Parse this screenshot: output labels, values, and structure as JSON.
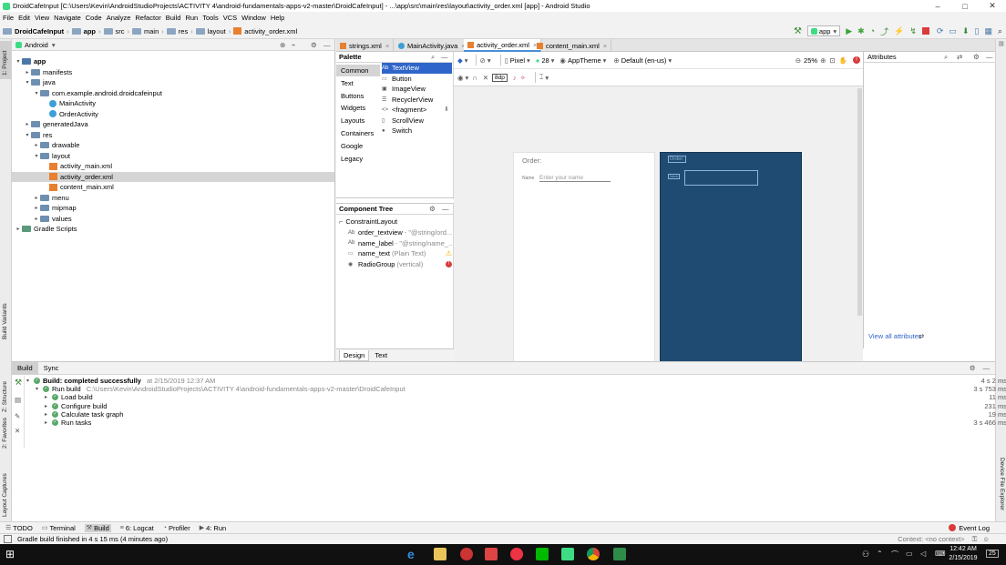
{
  "window": {
    "title": "DroidCafeInput [C:\\Users\\Kevin\\AndroidStudioProjects\\ACTIVITY 4\\android-fundamentals-apps-v2-master\\DroidCafeInput] - ...\\app\\src\\main\\res\\layout\\activity_order.xml [app] - Android Studio"
  },
  "menu": [
    "File",
    "Edit",
    "View",
    "Navigate",
    "Code",
    "Analyze",
    "Refactor",
    "Build",
    "Run",
    "Tools",
    "VCS",
    "Window",
    "Help"
  ],
  "breadcrumb": [
    "DroidCafeInput",
    "app",
    "src",
    "main",
    "res",
    "layout",
    "activity_order.xml"
  ],
  "run_config": "app",
  "left_strip": {
    "project": "1: Project",
    "build_variants": "Build Variants",
    "structure": "Z: Structure",
    "favorites": "2: Favorites",
    "layout_captures": "Layout Captures"
  },
  "right_strip": {
    "device_explorer": "Device File Explorer"
  },
  "project_panel": {
    "view": "Android"
  },
  "tree": [
    {
      "label": "app",
      "level": 0,
      "kind": "module",
      "arrow": "▾",
      "bold": true
    },
    {
      "label": "manifests",
      "level": 1,
      "kind": "folder",
      "arrow": "▸"
    },
    {
      "label": "java",
      "level": 1,
      "kind": "folder",
      "arrow": "▾"
    },
    {
      "label": "com.example.android.droidcafeinput",
      "level": 2,
      "kind": "folder",
      "arrow": "▾"
    },
    {
      "label": "MainActivity",
      "level": 3,
      "kind": "class",
      "arrow": ""
    },
    {
      "label": "OrderActivity",
      "level": 3,
      "kind": "class",
      "arrow": ""
    },
    {
      "label": "generatedJava",
      "level": 1,
      "kind": "folder",
      "arrow": "▸"
    },
    {
      "label": "res",
      "level": 1,
      "kind": "folder",
      "arrow": "▾"
    },
    {
      "label": "drawable",
      "level": 2,
      "kind": "folder",
      "arrow": "▸"
    },
    {
      "label": "layout",
      "level": 2,
      "kind": "folder",
      "arrow": "▾"
    },
    {
      "label": "activity_main.xml",
      "level": 3,
      "kind": "xml",
      "arrow": ""
    },
    {
      "label": "activity_order.xml",
      "level": 3,
      "kind": "xml",
      "arrow": "",
      "selected": true
    },
    {
      "label": "content_main.xml",
      "level": 3,
      "kind": "xml",
      "arrow": ""
    },
    {
      "label": "menu",
      "level": 2,
      "kind": "folder",
      "arrow": "▸"
    },
    {
      "label": "mipmap",
      "level": 2,
      "kind": "folder",
      "arrow": "▸"
    },
    {
      "label": "values",
      "level": 2,
      "kind": "folder",
      "arrow": "▸"
    },
    {
      "label": "Gradle Scripts",
      "level": 0,
      "kind": "gradle",
      "arrow": "▸"
    }
  ],
  "editor_tabs": [
    {
      "label": "strings.xml",
      "active": false
    },
    {
      "label": "MainActivity.java",
      "active": false
    },
    {
      "label": "activity_order.xml",
      "active": true
    },
    {
      "label": "content_main.xml",
      "active": false
    }
  ],
  "palette": {
    "title": "Palette",
    "categories": [
      "Common",
      "Text",
      "Buttons",
      "Widgets",
      "Layouts",
      "Containers",
      "Google",
      "Legacy"
    ],
    "widgets": [
      {
        "prefix": "Ab",
        "label": "TextView",
        "selected": true
      },
      {
        "prefix": "",
        "label": "Button"
      },
      {
        "prefix": "",
        "label": "ImageView"
      },
      {
        "prefix": "",
        "label": "RecyclerView"
      },
      {
        "prefix": "<>",
        "label": "<fragment>"
      },
      {
        "prefix": "",
        "label": "ScrollView"
      },
      {
        "prefix": "",
        "label": "Switch"
      }
    ]
  },
  "component_tree": {
    "title": "Component Tree",
    "root": "ConstraintLayout",
    "items": [
      {
        "prefix": "Ab",
        "name": "order_textview",
        "hint": "- \"@string/ord...",
        "status": ""
      },
      {
        "prefix": "Ab",
        "name": "name_label",
        "hint": "- \"@string/name_...",
        "status": ""
      },
      {
        "prefix": "",
        "name": "name_text",
        "hint": "(Plain Text)",
        "status": "warning"
      },
      {
        "prefix": "◉",
        "name": "RadioGroup",
        "hint": "(vertical)",
        "status": "error"
      }
    ]
  },
  "design_tabs": [
    "Design",
    "Text"
  ],
  "toolbar": {
    "device": "Pixel",
    "api": "28",
    "theme": "AppTheme",
    "locale": "Default (en-us)",
    "zoom": "25%",
    "margin": "8dp"
  },
  "canvas": {
    "order_label": "Order:",
    "name_label": "Name",
    "name_hint": "Enter your name",
    "blue_order": "Order:",
    "blue_name": "Name"
  },
  "attributes": {
    "title": "Attributes",
    "view_all": "View all attributes"
  },
  "build_panel": {
    "tabs": [
      "Build",
      "Sync"
    ],
    "rows": [
      {
        "text": "Build: completed successfully",
        "extra": "at 2/15/2019 12:37 AM",
        "duration": "4 s 2 ms",
        "level": 0,
        "bold": true
      },
      {
        "text": "Run build",
        "extra": "C:\\Users\\Kevin\\AndroidStudioProjects\\ACTIVITY 4\\android-fundamentals-apps-v2-master\\DroidCafeInput",
        "duration": "3 s 753 ms",
        "level": 1
      },
      {
        "text": "Load build",
        "extra": "",
        "duration": "11 ms",
        "level": 2
      },
      {
        "text": "Configure build",
        "extra": "",
        "duration": "231 ms",
        "level": 2
      },
      {
        "text": "Calculate task graph",
        "extra": "",
        "duration": "19 ms",
        "level": 2
      },
      {
        "text": "Run tasks",
        "extra": "",
        "duration": "3 s 466 ms",
        "level": 2
      }
    ]
  },
  "tool_windows": [
    "TODO",
    "Terminal",
    "Build",
    "6: Logcat",
    "Profiler",
    "4: Run"
  ],
  "event_log": "Event Log",
  "status": {
    "message": "Gradle build finished in 4 s 15 ms (4 minutes ago)",
    "context": "Context: <no context>"
  },
  "taskbar": {
    "time": "12:42 AM",
    "date": "2/15/2019",
    "badge": "25"
  },
  "colors": {
    "accent": "#4a8fd6",
    "blueprint": "#1f4b73",
    "selection": "#2f65ca",
    "success": "#59a869",
    "warning": "#f2b100",
    "error": "#d83b3b",
    "taskbar": "#101010"
  }
}
